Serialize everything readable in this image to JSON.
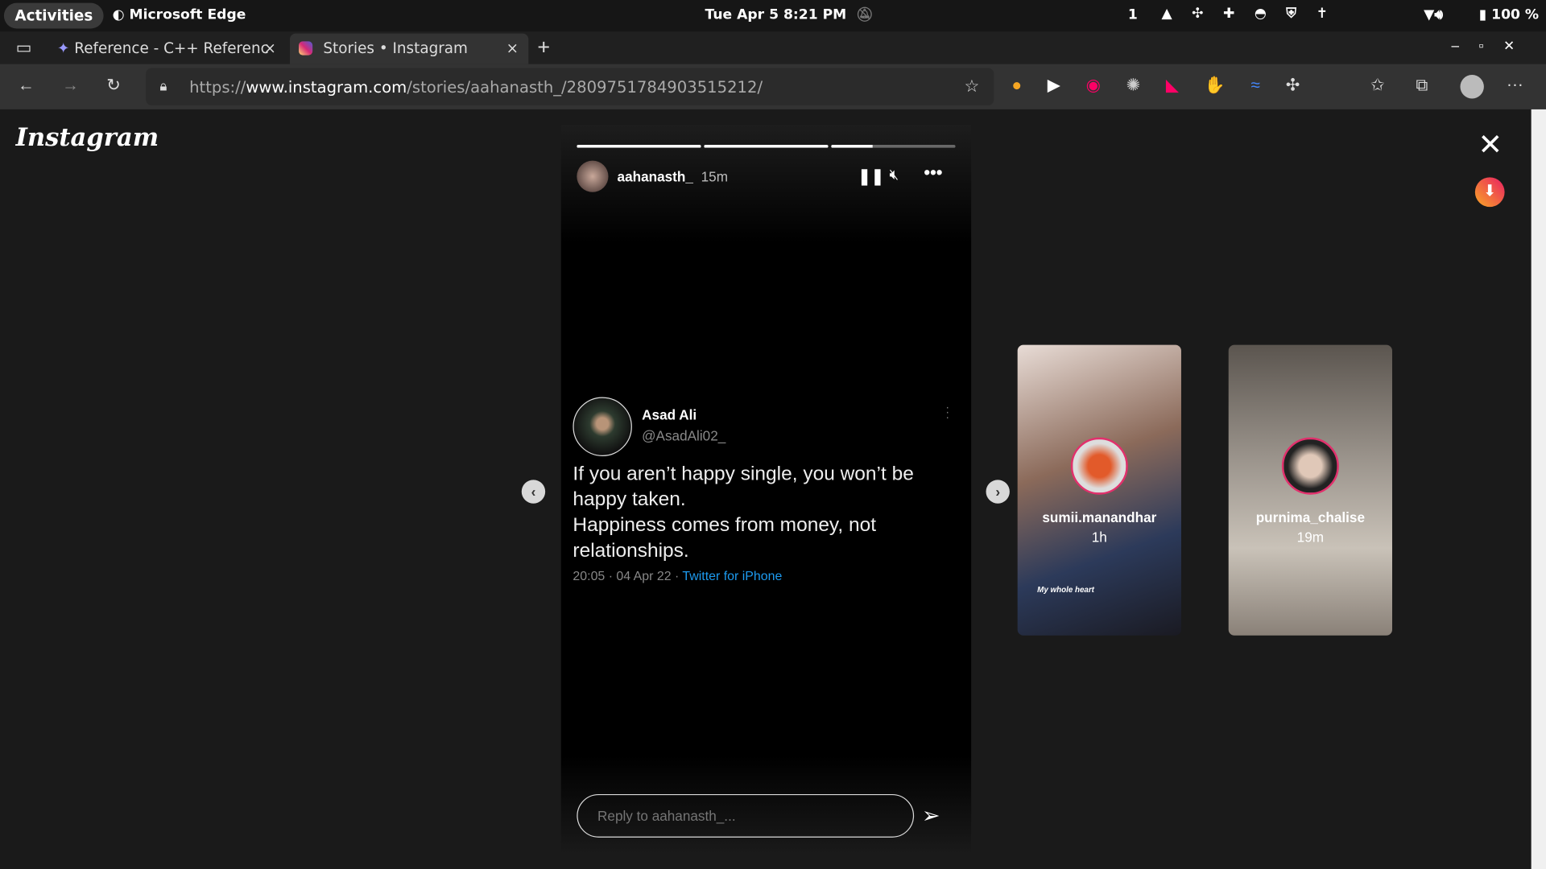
{
  "system": {
    "activities": "Activities",
    "app": "Microsoft Edge",
    "datetime": "Tue Apr 5  8:21 PM",
    "workspace": "1",
    "battery": "100 %"
  },
  "browser": {
    "tabs": [
      {
        "label": "Reference - C++ Referenc",
        "active": false
      },
      {
        "label": "Stories • Instagram",
        "active": true
      }
    ],
    "url_prefix": "https://",
    "url_host": "www.instagram.com",
    "url_path": "/stories/aahanasth_/2809751784903515212/"
  },
  "instagram": {
    "logo": "Instagram",
    "story": {
      "username": "aahanasth_",
      "time": "15m",
      "progress": [
        1,
        1,
        0.33
      ],
      "tweet": {
        "name": "Asad Ali",
        "handle": "@AsadAli02_",
        "lines": [
          "If you aren’t happy single, you won’t be",
          "happy taken.",
          "Happiness comes from money, not",
          "relationships."
        ],
        "meta": "20:05 · 04 Apr 22 · ",
        "source": "Twitter for iPhone"
      },
      "reply_placeholder": "Reply to aahanasth_..."
    },
    "next_stories": [
      {
        "username": "sumii.manandhar",
        "time": "1h",
        "caption": "My whole heart"
      },
      {
        "username": "purnima_chalise",
        "time": "19m"
      }
    ]
  },
  "colors": {
    "accent": "#1d9bf0",
    "ring": "#e1306c"
  }
}
